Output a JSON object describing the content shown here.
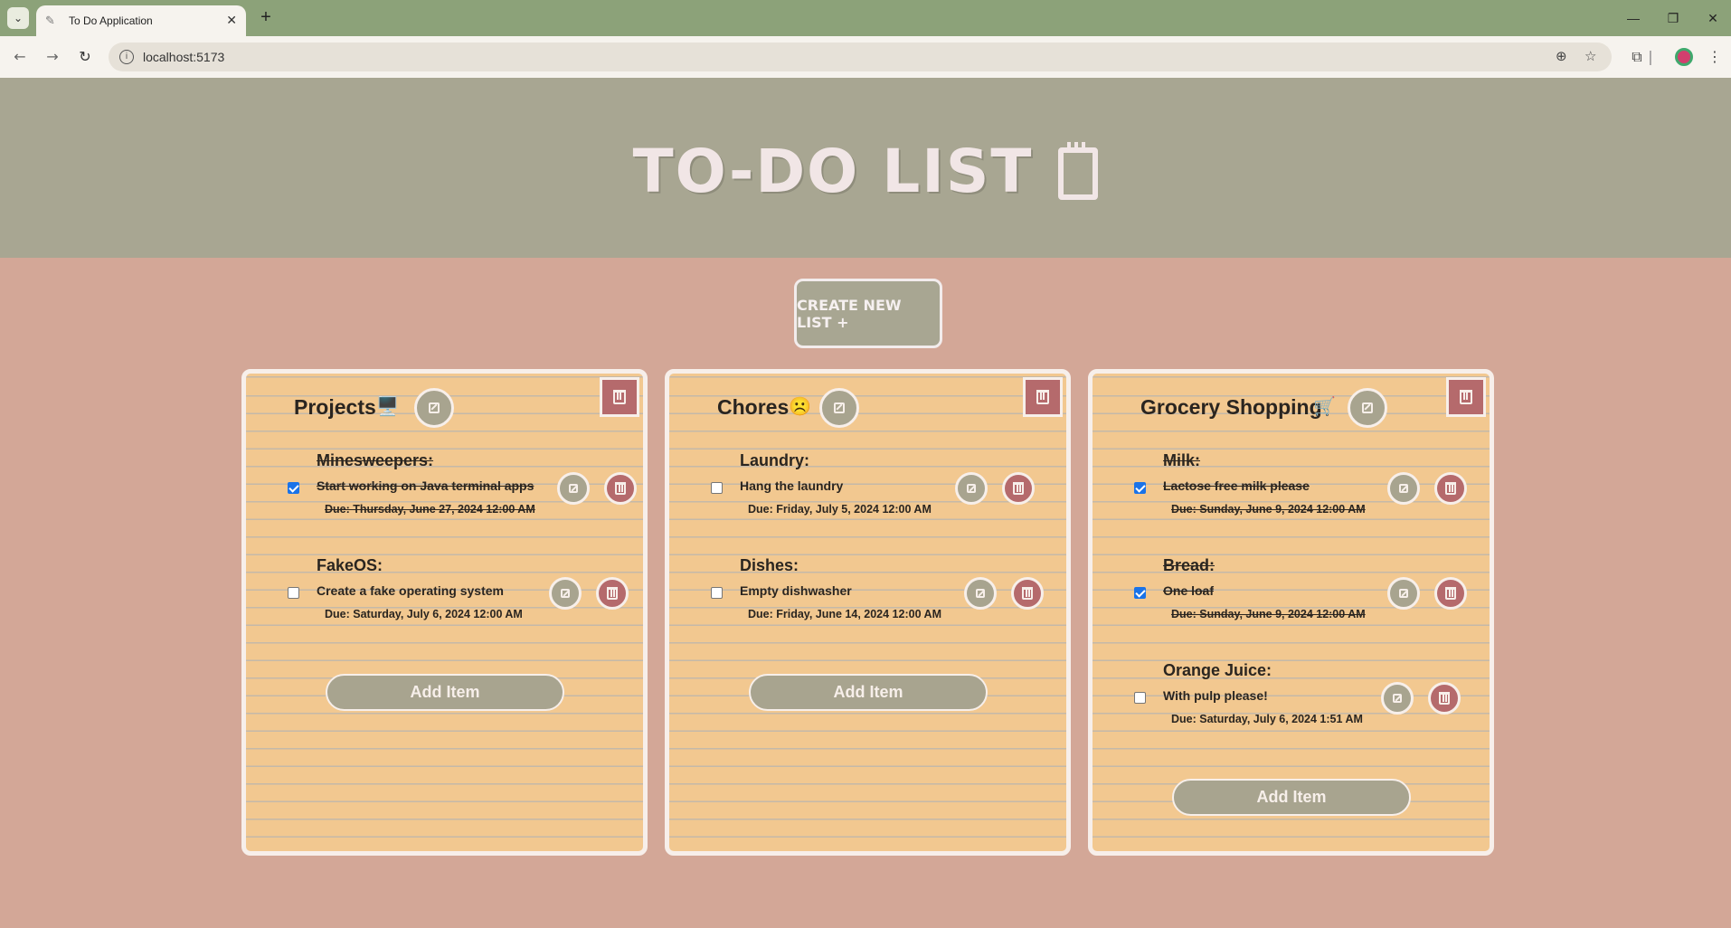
{
  "browser": {
    "tab_title": "To Do Application",
    "new_tab_label": "+",
    "url": "localhost:5173"
  },
  "page": {
    "title": "TO-DO LIST",
    "create_button": "CREATE NEW LIST +"
  },
  "lists": [
    {
      "title": "Projects",
      "emoji": "🖥️",
      "items": [
        {
          "name": "Minesweepers:",
          "desc": "Start working on Java terminal apps",
          "due": "Due: Thursday, June 27, 2024 12:00 AM",
          "done": true
        },
        {
          "name": "FakeOS:",
          "desc": "Create a fake operating system",
          "due": "Due: Saturday, July 6, 2024 12:00 AM",
          "done": false
        }
      ],
      "add_label": "Add Item"
    },
    {
      "title": "Chores",
      "emoji": "☹️",
      "items": [
        {
          "name": "Laundry:",
          "desc": "Hang the laundry",
          "due": "Due: Friday, July 5, 2024 12:00 AM",
          "done": false
        },
        {
          "name": "Dishes:",
          "desc": "Empty dishwasher",
          "due": "Due: Friday, June 14, 2024 12:00 AM",
          "done": false
        }
      ],
      "add_label": "Add Item"
    },
    {
      "title": "Grocery Shopping",
      "emoji": "🛒",
      "items": [
        {
          "name": "Milk:",
          "desc": "Lactose free milk please",
          "due": "Due: Sunday, June 9, 2024 12:00 AM",
          "done": true
        },
        {
          "name": "Bread:",
          "desc": "One loaf",
          "due": "Due: Sunday, June 9, 2024 12:00 AM",
          "done": true
        },
        {
          "name": "Orange Juice:",
          "desc": "With pulp please!",
          "due": "Due: Saturday, July 6, 2024 1:51 AM",
          "done": false
        }
      ],
      "add_label": "Add Item"
    }
  ]
}
